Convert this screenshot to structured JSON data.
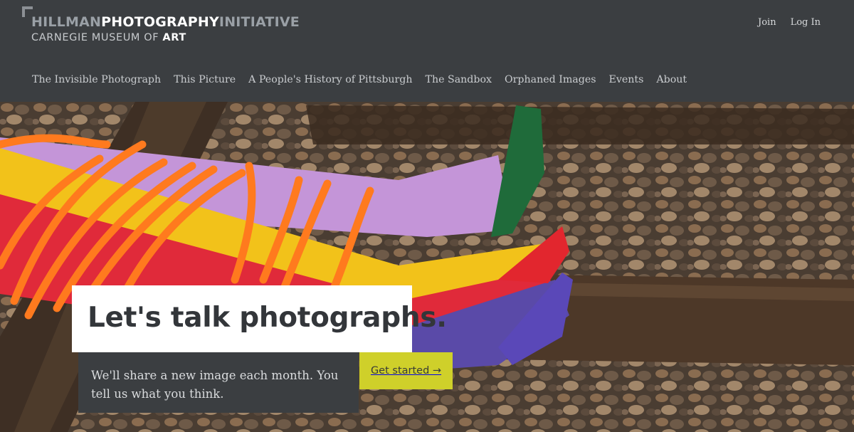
{
  "logo": {
    "word1": "HILLMAN",
    "word2": "PHOTOGRAPHY",
    "word3": "INITIATIVE",
    "line2_main": "CARNEGIE MUSEUM OF ",
    "line2_bold": "ART"
  },
  "topnav": {
    "join": "Join",
    "login": "Log In"
  },
  "mainnav": {
    "items": [
      "The Invisible Photograph",
      "This Picture",
      "A People's History of Pittsburgh",
      "The Sandbox",
      "Orphaned Images",
      "Events",
      "About"
    ]
  },
  "hero": {
    "headline": "Let's talk photographs.",
    "subtext": "We'll share a new image each month. You tell us what you think.",
    "cta": "Get started →"
  },
  "colors": {
    "header_bg": "#3b3e41",
    "cta_bg": "#cfd02a",
    "headline_box": "#ffffff"
  }
}
